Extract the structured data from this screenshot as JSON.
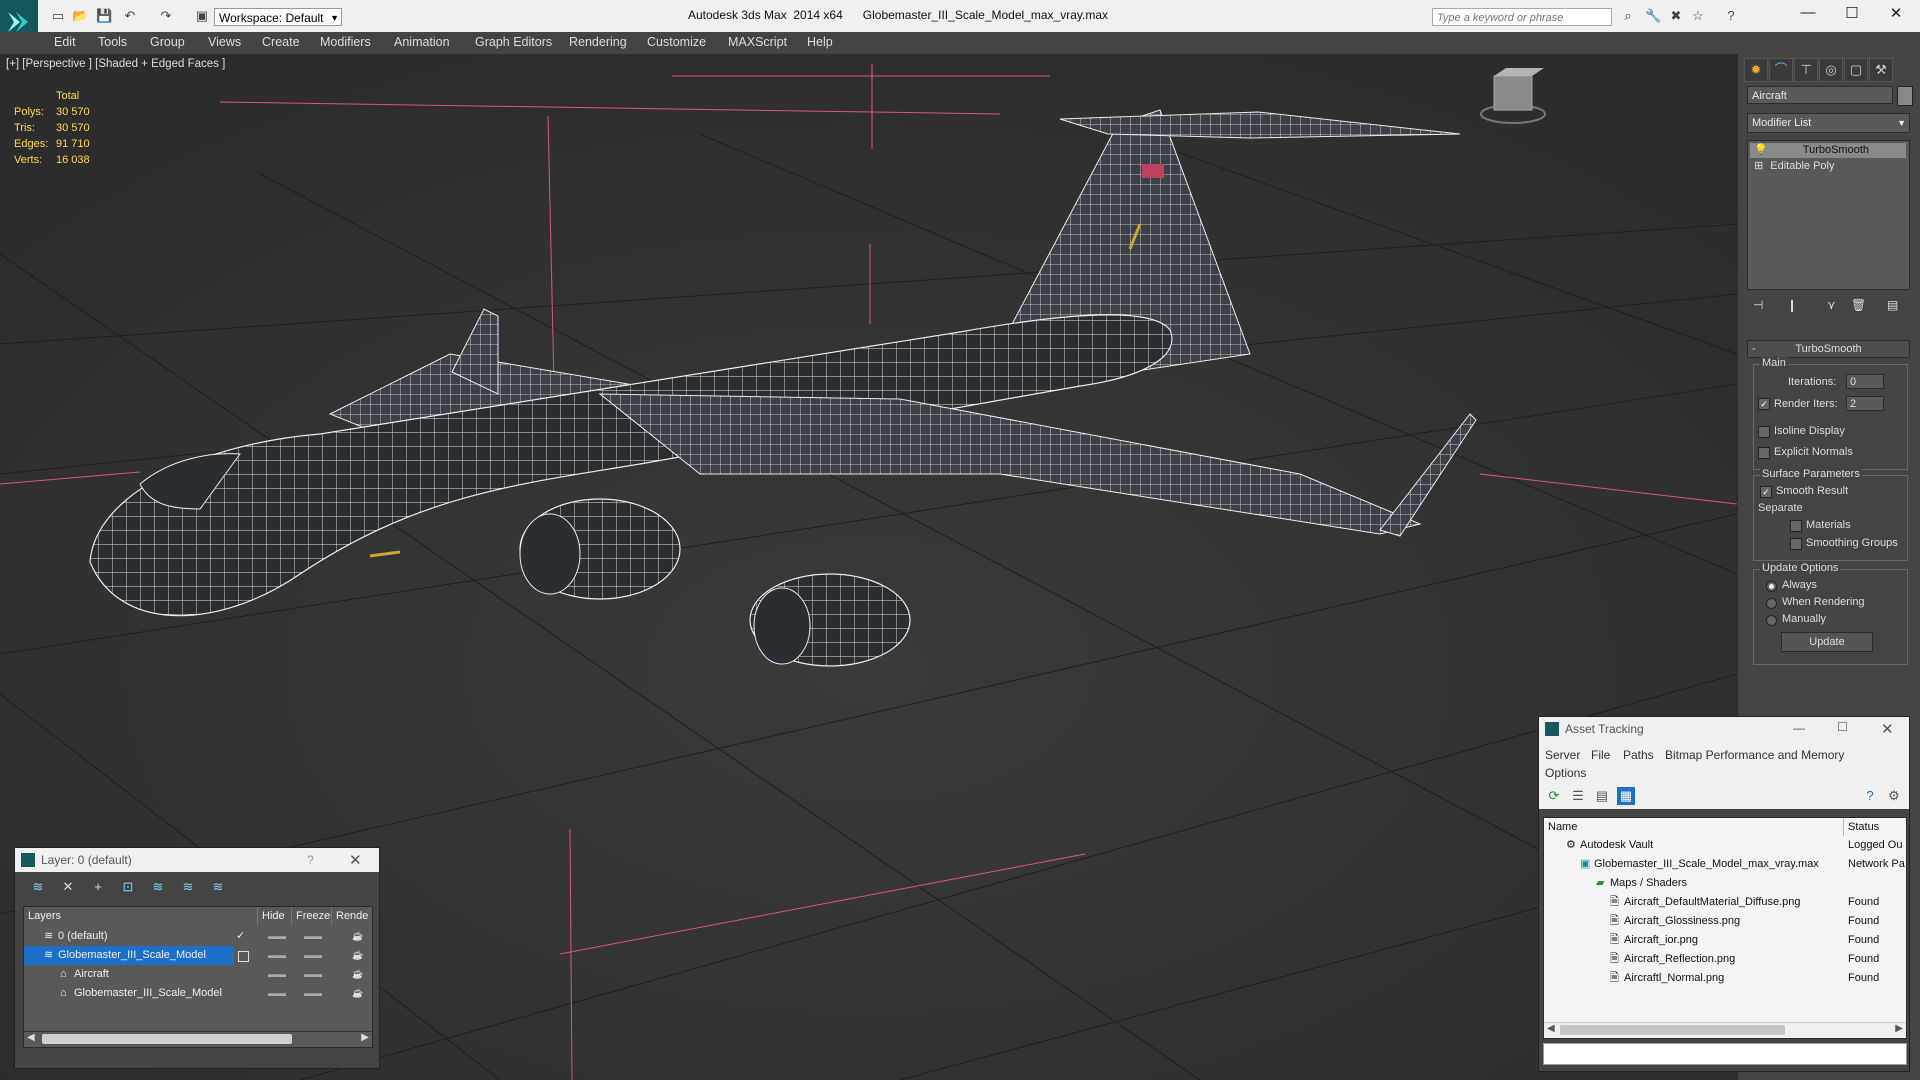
{
  "app": {
    "title": "Autodesk 3ds Max  2014 x64      Globemaster_III_Scale_Model_max_vray.max",
    "workspace": "Workspace: Default",
    "search_placeholder": "Type a keyword or phrase"
  },
  "menu": [
    "Edit",
    "Tools",
    "Group",
    "Views",
    "Create",
    "Modifiers",
    "Animation",
    "Graph Editors",
    "Rendering",
    "Customize",
    "MAXScript",
    "Help"
  ],
  "viewport": {
    "label": "[+] [Perspective ] [Shaded + Edged Faces ]",
    "stats": {
      "header": "Total",
      "polys_label": "Polys:",
      "polys": "30 570",
      "tris_label": "Tris:",
      "tris": "30 570",
      "edges_label": "Edges:",
      "edges": "91 710",
      "verts_label": "Verts:",
      "verts": "16 038"
    }
  },
  "command_panel": {
    "object_name": "Aircraft",
    "modifier_list": "Modifier List",
    "stack": [
      "TurboSmooth",
      "Editable Poly"
    ],
    "rollout_title": "TurboSmooth",
    "main_group": "Main",
    "iterations_label": "Iterations:",
    "iterations": "0",
    "render_iters_label": "Render Iters:",
    "render_iters": "2",
    "isoline": "Isoline Display",
    "explicit_normals": "Explicit Normals",
    "surface_params": "Surface Parameters",
    "smooth_result": "Smooth Result",
    "separate": "Separate",
    "materials": "Materials",
    "smoothing_groups": "Smoothing Groups",
    "update_options": "Update Options",
    "always": "Always",
    "when_rendering": "When Rendering",
    "manually": "Manually",
    "update_button": "Update"
  },
  "layer_dialog": {
    "title": "Layer: 0 (default)",
    "help": "?",
    "columns": [
      "Layers",
      "Hide",
      "Freeze",
      "Rende"
    ],
    "rows": [
      "0 (default)",
      "Globemaster_III_Scale_Model",
      "Aircraft",
      "Globemaster_III_Scale_Model"
    ]
  },
  "asset_dialog": {
    "title": "Asset Tracking",
    "menu": [
      "Server",
      "File",
      "Paths",
      "Bitmap Performance and Memory",
      "Options"
    ],
    "columns": [
      "Name",
      "Status"
    ],
    "rows": [
      {
        "name": "Autodesk Vault",
        "status": "Logged Ou"
      },
      {
        "name": "Globemaster_III_Scale_Model_max_vray.max",
        "status": "Network Pa"
      },
      {
        "name": "Maps / Shaders",
        "status": ""
      },
      {
        "name": "Aircraft_DefaultMaterial_Diffuse.png",
        "status": "Found"
      },
      {
        "name": "Aircraft_Glossiness.png",
        "status": "Found"
      },
      {
        "name": "Aircraft_ior.png",
        "status": "Found"
      },
      {
        "name": "Aircraft_Reflection.png",
        "status": "Found"
      },
      {
        "name": "Aircraftl_Normal.png",
        "status": "Found"
      }
    ]
  }
}
